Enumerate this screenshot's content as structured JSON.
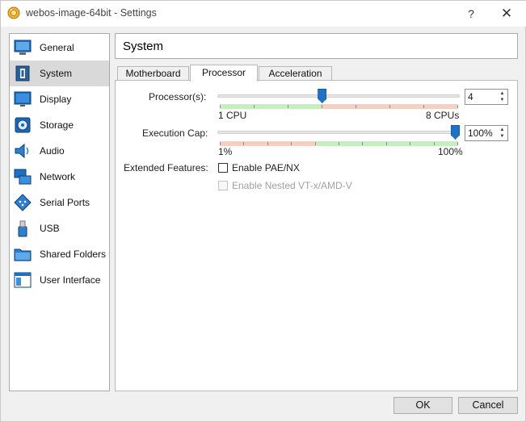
{
  "window": {
    "title": "webos-image-64bit - Settings",
    "help_label": "?",
    "close_label": "✕"
  },
  "sidebar": {
    "items": [
      {
        "label": "General",
        "icon": "monitor-general-icon"
      },
      {
        "label": "System",
        "icon": "chip-system-icon",
        "selected": true
      },
      {
        "label": "Display",
        "icon": "display-icon"
      },
      {
        "label": "Storage",
        "icon": "storage-disk-icon"
      },
      {
        "label": "Audio",
        "icon": "speaker-audio-icon"
      },
      {
        "label": "Network",
        "icon": "network-icon"
      },
      {
        "label": "Serial Ports",
        "icon": "serial-port-icon"
      },
      {
        "label": "USB",
        "icon": "usb-icon"
      },
      {
        "label": "Shared Folders",
        "icon": "folder-icon"
      },
      {
        "label": "User Interface",
        "icon": "user-interface-icon"
      }
    ]
  },
  "header": {
    "title": "System"
  },
  "tabs": [
    {
      "label": "Motherboard"
    },
    {
      "label": "Processor",
      "active": true
    },
    {
      "label": "Acceleration"
    }
  ],
  "processor": {
    "processors_label": "Processor(s):",
    "processors_value": "4",
    "processors_min_label": "1 CPU",
    "processors_max_label": "8 CPUs",
    "processors_fraction": 0.43,
    "exec_cap_label": "Execution Cap:",
    "exec_cap_value": "100%",
    "exec_cap_min_label": "1%",
    "exec_cap_max_label": "100%",
    "exec_cap_fraction": 1.0,
    "extended_label": "Extended Features:",
    "pae_label": "Enable PAE/NX",
    "pae_checked": false,
    "nested_label": "Enable Nested VT-x/AMD-V",
    "nested_checked": false,
    "nested_enabled": false
  },
  "buttons": {
    "ok": "OK",
    "cancel": "Cancel"
  },
  "colors": {
    "accent": "#1f73c6",
    "zone_green": "#c6efc0",
    "zone_red": "#f7cfc2",
    "selected_bg": "#d9d9d9"
  }
}
